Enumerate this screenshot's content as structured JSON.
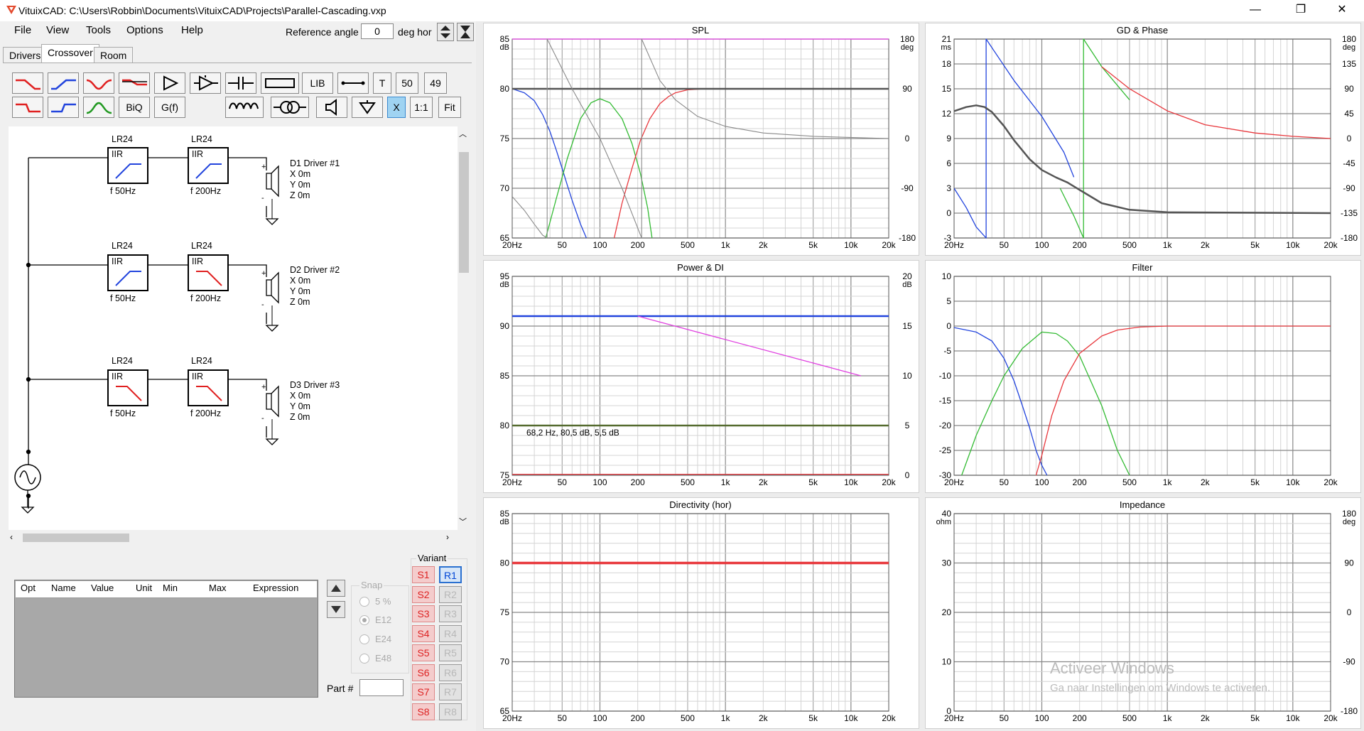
{
  "window": {
    "title": "VituixCAD: C:\\Users\\Robbin\\Documents\\VituixCAD\\Projects\\Parallel-Cascading.vxp",
    "minimize": "—",
    "restore": "❐",
    "close": "✕"
  },
  "menu": [
    "File",
    "View",
    "Tools",
    "Options",
    "Help"
  ],
  "reference": {
    "label": "Reference angle",
    "value": "0",
    "unit": "deg hor"
  },
  "tabs": [
    "Drivers",
    "Crossover",
    "Room"
  ],
  "toolbar": {
    "lib": "LIB",
    "t": "T",
    "n50": "50",
    "n49": "49",
    "biq": "BiQ",
    "gf": "G(f)",
    "x": "X",
    "one": "1:1",
    "fit": "Fit"
  },
  "branches": [
    {
      "b1_type": "LR24",
      "b1_kind": "IIR",
      "b1_f": "f   50Hz",
      "b2_type": "LR24",
      "b2_kind": "IIR",
      "b2_f": "f   200Hz",
      "driver": "D1 Driver #1",
      "x": "X 0m",
      "y": "Y 0m",
      "z": "Z 0m"
    },
    {
      "b1_type": "LR24",
      "b1_kind": "IIR",
      "b1_f": "f   50Hz",
      "b2_type": "LR24",
      "b2_kind": "IIR",
      "b2_f": "f   200Hz",
      "driver": "D2 Driver #2",
      "x": "X 0m",
      "y": "Y 0m",
      "z": "Z 0m"
    },
    {
      "b1_type": "LR24",
      "b1_kind": "IIR",
      "b1_f": "f   50Hz",
      "b2_type": "LR24",
      "b2_kind": "IIR",
      "b2_f": "f   200Hz",
      "driver": "D3 Driver #3",
      "x": "X 0m",
      "y": "Y 0m",
      "z": "Z 0m"
    }
  ],
  "params": {
    "headers": [
      "Opt",
      "Name",
      "Value",
      "Unit",
      "Min",
      "Max",
      "Expression"
    ]
  },
  "snap": {
    "label": "Snap",
    "options": [
      "5 %",
      "E12",
      "E24",
      "E48"
    ],
    "selected": "E12"
  },
  "part": {
    "label": "Part #",
    "value": ""
  },
  "variant": {
    "label": "Variant",
    "s": [
      "S1",
      "S2",
      "S3",
      "S4",
      "S5",
      "S6",
      "S7",
      "S8"
    ],
    "r": [
      "R1",
      "R2",
      "R3",
      "R4",
      "R5",
      "R6",
      "R7",
      "R8"
    ]
  },
  "watermark": {
    "line1": "Activeer Windows",
    "line2": "Ga naar Instellingen om Windows te activeren."
  },
  "colors": {
    "red": "#e8383d",
    "blue": "#2244dd",
    "green": "#33bb33",
    "gray": "#8a8a8a",
    "dark": "#555555",
    "magenta": "#e040e0",
    "olive": "#556b2f"
  },
  "chart_data": [
    {
      "title": "SPL",
      "type": "line",
      "xscale": "log",
      "xlim": [
        20,
        20000
      ],
      "xticks": [
        "20Hz",
        "50",
        "100",
        "200",
        "500",
        "1k",
        "2k",
        "5k",
        "10k",
        "20k"
      ],
      "ylabel": "dB",
      "ylim": [
        65,
        85
      ],
      "yticks": [
        "85",
        "80",
        "75",
        "70",
        "65"
      ],
      "y2label": "deg",
      "y2lim": [
        -180,
        180
      ],
      "y2ticks": [
        "180",
        "90",
        "0",
        "-90",
        "-180"
      ],
      "series": [
        {
          "color": "blue",
          "x": [
            20,
            25,
            30,
            35,
            40,
            45,
            50,
            55,
            60,
            70,
            78
          ],
          "y": [
            80,
            79.6,
            78.8,
            77.4,
            75.7,
            73.8,
            72,
            70.3,
            68.8,
            66.4,
            65
          ]
        },
        {
          "color": "green",
          "x": [
            37,
            45,
            55,
            70,
            85,
            100,
            120,
            150,
            180,
            210,
            240,
            260
          ],
          "y": [
            65,
            69,
            73,
            77,
            78.6,
            79,
            78.6,
            77,
            74.5,
            71.5,
            68,
            65
          ]
        },
        {
          "color": "red",
          "x": [
            130,
            150,
            180,
            210,
            250,
            300,
            350,
            400,
            500,
            700,
            1000,
            20000
          ],
          "y": [
            65,
            68.5,
            72,
            74.8,
            77,
            78.5,
            79.2,
            79.6,
            79.9,
            80,
            80,
            80
          ]
        },
        {
          "color": "dark",
          "x": [
            20,
            20000
          ],
          "y": [
            80,
            80
          ]
        },
        {
          "color": "magenta",
          "x": [
            20,
            20000
          ],
          "y": [
            85,
            85
          ]
        },
        {
          "color": "gray",
          "axis": "right",
          "x": [
            20,
            25,
            30,
            35,
            38
          ],
          "y": [
            -105,
            -130,
            -155,
            -175,
            -180
          ]
        },
        {
          "color": "gray",
          "axis": "right",
          "x": [
            38,
            38,
            60,
            100,
            150,
            215
          ],
          "y": [
            -180,
            180,
            90,
            0,
            -90,
            -180
          ]
        },
        {
          "color": "gray",
          "axis": "right",
          "x": [
            215,
            215,
            300,
            400,
            600,
            1000,
            2000,
            5000,
            20000
          ],
          "y": [
            -180,
            180,
            105,
            70,
            40,
            22,
            10,
            4,
            0
          ]
        }
      ]
    },
    {
      "title": "GD & Phase",
      "type": "line",
      "xscale": "log",
      "xlim": [
        20,
        20000
      ],
      "xticks": [
        "20Hz",
        "50",
        "100",
        "200",
        "500",
        "1k",
        "2k",
        "5k",
        "10k",
        "20k"
      ],
      "ylabel": "ms",
      "ylim": [
        -3,
        21
      ],
      "yticks": [
        "21",
        "18",
        "15",
        "12",
        "9",
        "6",
        "3",
        "0",
        "-3"
      ],
      "y2label": "deg",
      "y2lim": [
        -180,
        180
      ],
      "y2ticks": [
        "180",
        "135",
        "90",
        "45",
        "0",
        "-45",
        "-90",
        "-135",
        "-180"
      ],
      "series": [
        {
          "color": "blue",
          "axis": "right",
          "x": [
            20,
            25,
            30,
            36,
            36,
            60,
            100,
            150,
            180
          ],
          "y": [
            -90,
            -125,
            -160,
            -180,
            180,
            105,
            40,
            -25,
            -70
          ]
        },
        {
          "color": "green",
          "axis": "right",
          "x": [
            140,
            180,
            215,
            215,
            300,
            500
          ],
          "y": [
            -90,
            -140,
            -180,
            180,
            130,
            70
          ]
        },
        {
          "color": "red",
          "axis": "right",
          "x": [
            300,
            500,
            1000,
            2000,
            5000,
            10000,
            20000
          ],
          "y": [
            130,
            90,
            50,
            25,
            10,
            4,
            0
          ]
        },
        {
          "color": "dark",
          "x": [
            20,
            25,
            30,
            35,
            40,
            50,
            60,
            80,
            100,
            130,
            160,
            200,
            300,
            500,
            1000,
            20000
          ],
          "y": [
            12.3,
            12.8,
            13,
            12.8,
            12.2,
            10.5,
            8.8,
            6.5,
            5.2,
            4.3,
            3.7,
            2.8,
            1.2,
            0.4,
            0.1,
            0
          ]
        }
      ]
    },
    {
      "title": "Power & DI",
      "type": "line",
      "xscale": "log",
      "xlim": [
        20,
        20000
      ],
      "xticks": [
        "20Hz",
        "50",
        "100",
        "200",
        "500",
        "1k",
        "2k",
        "5k",
        "10k",
        "20k"
      ],
      "ylabel": "dB",
      "ylim": [
        75,
        95
      ],
      "yticks": [
        "95",
        "90",
        "85",
        "80",
        "75"
      ],
      "y2label": "dB",
      "y2lim": [
        0,
        20
      ],
      "y2ticks": [
        "20",
        "15",
        "10",
        "5",
        "0"
      ],
      "annotation": "68,2 Hz, 80,5 dB, 5,5 dB",
      "series": [
        {
          "color": "blue",
          "x": [
            20,
            20000
          ],
          "y": [
            91,
            91
          ]
        },
        {
          "color": "magenta",
          "x": [
            200,
            12000
          ],
          "y": [
            91,
            85
          ]
        },
        {
          "color": "olive",
          "x": [
            20,
            20000
          ],
          "y": [
            80,
            80
          ]
        },
        {
          "color": "red",
          "x": [
            20,
            20000
          ],
          "y": [
            75.1,
            75.1
          ]
        }
      ]
    },
    {
      "title": "Filter",
      "type": "line",
      "xscale": "log",
      "xlim": [
        20,
        20000
      ],
      "xticks": [
        "20Hz",
        "50",
        "100",
        "200",
        "500",
        "1k",
        "2k",
        "5k",
        "10k",
        "20k"
      ],
      "ylim": [
        -30,
        10
      ],
      "yticks": [
        "10",
        "5",
        "0",
        "-5",
        "-10",
        "-15",
        "-20",
        "-25",
        "-30"
      ],
      "series": [
        {
          "color": "blue",
          "x": [
            20,
            30,
            40,
            50,
            60,
            70,
            80,
            90,
            100,
            110
          ],
          "y": [
            -0.3,
            -1.2,
            -3,
            -6.5,
            -11,
            -16,
            -20.5,
            -25,
            -28,
            -30
          ]
        },
        {
          "color": "green",
          "x": [
            23,
            30,
            40,
            50,
            70,
            100,
            130,
            160,
            200,
            300,
            400,
            500
          ],
          "y": [
            -30,
            -22,
            -15,
            -10,
            -4.5,
            -1.2,
            -1.5,
            -3,
            -6,
            -16,
            -25,
            -30
          ]
        },
        {
          "color": "red",
          "x": [
            90,
            100,
            120,
            150,
            200,
            300,
            400,
            600,
            1000,
            20000
          ],
          "y": [
            -30,
            -26,
            -18,
            -11,
            -5.5,
            -2,
            -0.8,
            -0.2,
            0,
            0
          ]
        }
      ]
    },
    {
      "title": "Directivity (hor)",
      "type": "line",
      "xscale": "log",
      "xlim": [
        20,
        20000
      ],
      "xticks": [
        "20Hz",
        "50",
        "100",
        "200",
        "500",
        "1k",
        "2k",
        "5k",
        "10k",
        "20k"
      ],
      "ylabel": "dB",
      "ylim": [
        65,
        85
      ],
      "yticks": [
        "85",
        "80",
        "75",
        "70",
        "65"
      ],
      "series": [
        {
          "color": "red",
          "x": [
            20,
            20000
          ],
          "y": [
            80,
            80
          ]
        }
      ]
    },
    {
      "title": "Impedance",
      "type": "line",
      "xscale": "log",
      "xlim": [
        20,
        20000
      ],
      "xticks": [
        "20Hz",
        "50",
        "100",
        "200",
        "500",
        "1k",
        "2k",
        "5k",
        "10k",
        "20k"
      ],
      "ylabel": "ohm",
      "ylim": [
        0,
        40
      ],
      "yticks": [
        "40",
        "30",
        "20",
        "10",
        "0"
      ],
      "y2label": "deg",
      "y2lim": [
        -180,
        180
      ],
      "y2ticks": [
        "180",
        "90",
        "0",
        "-90",
        "-180"
      ],
      "series": []
    }
  ]
}
